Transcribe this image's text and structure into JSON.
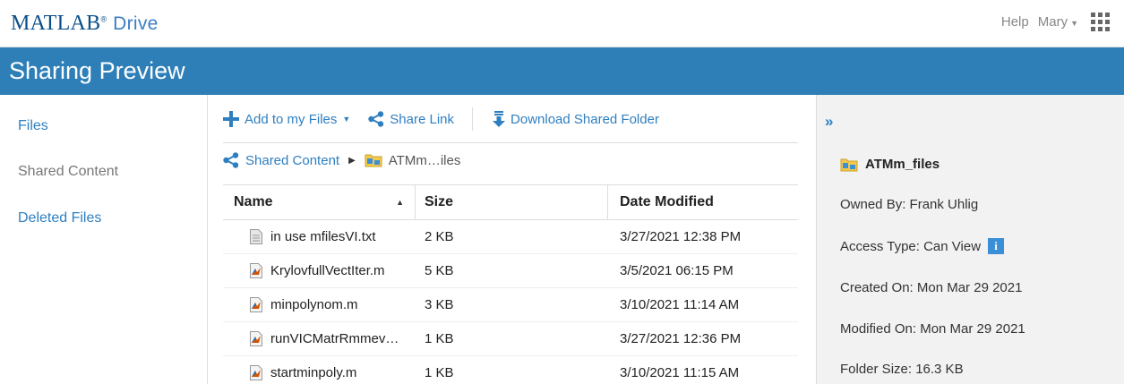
{
  "brand": {
    "matlab": "MATLAB",
    "reg": "®",
    "drive": "Drive"
  },
  "topbar": {
    "help": "Help",
    "user": "Mary"
  },
  "titlebar": {
    "title": "Sharing Preview"
  },
  "sidebar": {
    "items": [
      {
        "label": "Files",
        "state": "link"
      },
      {
        "label": "Shared Content",
        "state": "current"
      },
      {
        "label": "Deleted Files",
        "state": "link"
      }
    ]
  },
  "toolbar": {
    "add_label": "Add to my Files",
    "share_label": "Share Link",
    "download_label": "Download Shared Folder"
  },
  "breadcrumb": {
    "root": "Shared Content",
    "current": "ATMm…iles"
  },
  "table": {
    "headers": {
      "name": "Name",
      "size": "Size",
      "date": "Date Modified"
    },
    "rows": [
      {
        "icon": "text-file-icon",
        "name": "in use mfilesVI.txt",
        "size": "2 KB",
        "date": "3/27/2021 12:38 PM"
      },
      {
        "icon": "m-file-icon",
        "name": "KrylovfullVectIter.m",
        "size": "5 KB",
        "date": "3/5/2021 06:15 PM"
      },
      {
        "icon": "m-file-icon",
        "name": "minpolynom.m",
        "size": "3 KB",
        "date": "3/10/2021 11:14 AM"
      },
      {
        "icon": "m-file-icon",
        "name": "runVICMatrRmmev…",
        "size": "1 KB",
        "date": "3/27/2021 12:36 PM"
      },
      {
        "icon": "m-file-icon",
        "name": "startminpoly.m",
        "size": "1 KB",
        "date": "3/10/2021 11:15 AM"
      }
    ]
  },
  "details": {
    "folder_name": "ATMm_files",
    "owned_by": "Owned By: Frank Uhlig",
    "access_type": "Access Type: Can View",
    "created_on": "Created On: Mon Mar 29 2021",
    "modified_on": "Modified On: Mon Mar 29 2021",
    "folder_size": "Folder Size: 16.3 KB"
  },
  "colors": {
    "accent": "#2e7fb8",
    "link": "#2f7fc0",
    "panel_bg": "#f2f2f2"
  }
}
